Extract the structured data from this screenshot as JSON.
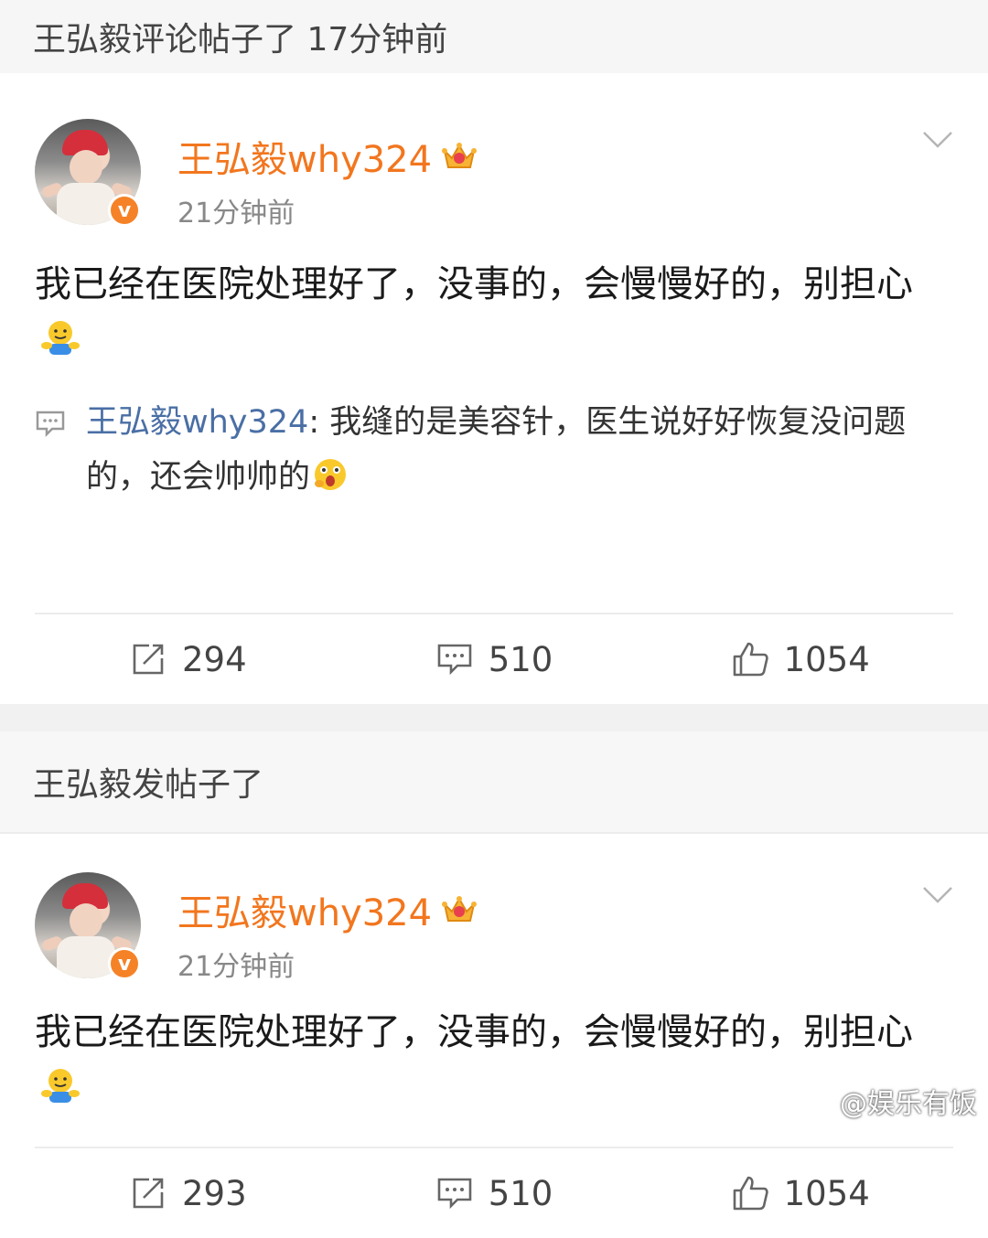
{
  "section1": {
    "header": "王弘毅评论帖子了 17分钟前",
    "post": {
      "username": "王弘毅why324",
      "time": "21分钟前",
      "text": "我已经在医院处理好了，没事的，会慢慢好的，别担心",
      "reply_name": "王弘毅why324",
      "reply_text": ": 我缝的是美容针，医生说好好恢复没问题的，还会帅帅的",
      "actions": {
        "repost": "294",
        "comment": "510",
        "like": "1054"
      }
    }
  },
  "section2": {
    "header": "王弘毅发帖子了",
    "post": {
      "username": "王弘毅why324",
      "time": "21分钟前",
      "text": "我已经在医院处理好了，没事的，会慢慢好的，别担心",
      "actions": {
        "repost": "293",
        "comment": "510",
        "like": "1054"
      }
    }
  },
  "watermark": "@娱乐有饭",
  "colors": {
    "username": "#f2761e",
    "reply_name": "#4a6fa5",
    "verified": "#f58227"
  },
  "icons": [
    "crown-icon",
    "chevron-down-icon",
    "verified-icon",
    "comment-icon",
    "repost-icon",
    "like-icon",
    "hug-emoji",
    "surprised-emoji"
  ]
}
